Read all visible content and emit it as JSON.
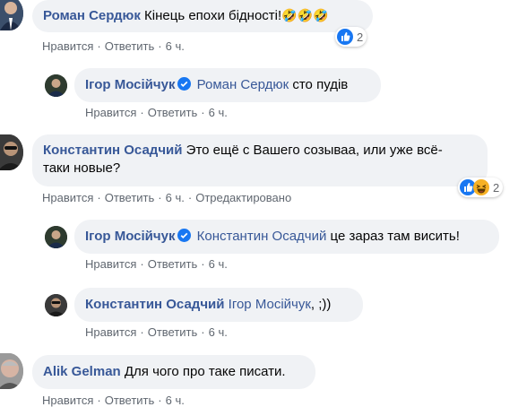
{
  "comments": [
    {
      "author": "Роман Сердюк",
      "text": "Кінець епохи бідності!",
      "emoji": "🤣🤣🤣",
      "actions": [
        "Нравится",
        "Ответить"
      ],
      "time": "6 ч.",
      "reaction_count": "2"
    },
    {
      "author": "Ігор Мосійчук",
      "mention": "Роман Сердюк",
      "text": "сто пудів",
      "actions": [
        "Нравится",
        "Ответить"
      ],
      "time": "6 ч."
    },
    {
      "author": "Константин Осадчий",
      "text_line1": "Это ещё с Вашего созываа, или уже всё-",
      "text_line2": "таки новые?",
      "actions": [
        "Нравится",
        "Ответить"
      ],
      "time": "6 ч.",
      "edited": "Отредактировано",
      "reaction_count": "2"
    },
    {
      "author": "Ігор Мосійчук",
      "mention": "Константин Осадчий",
      "text": "це зараз там висить!",
      "actions": [
        "Нравится",
        "Ответить"
      ],
      "time": "6 ч."
    },
    {
      "author": "Константин Осадчий",
      "mention": "Ігор Мосійчук",
      "text": ", ;))",
      "actions": [
        "Нравится",
        "Ответить"
      ],
      "time": "6 ч."
    },
    {
      "author": "Alik Gelman",
      "text": "Для чого про таке писати.",
      "actions": [
        "Нравится",
        "Ответить"
      ],
      "time": "6 ч."
    }
  ],
  "colors": {
    "link": "#385898",
    "meta": "#606770",
    "bubble": "#f0f2f5",
    "like_blue": "#1877f2",
    "haha_yellow": "#f7b125"
  },
  "icons": {
    "verified": "verified-badge-icon",
    "like": "like-reaction-icon",
    "haha": "haha-reaction-icon"
  }
}
